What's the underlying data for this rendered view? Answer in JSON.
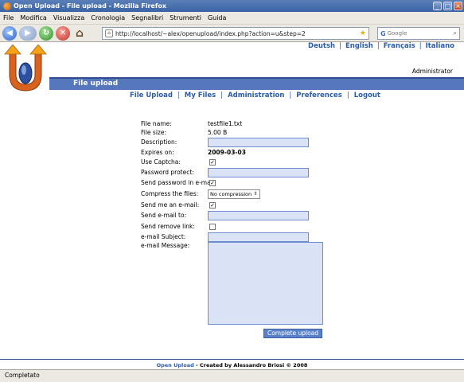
{
  "window": {
    "title": "Open Upload - File upload - Mozilla Firefox",
    "controls": [
      "_",
      "□",
      "×"
    ]
  },
  "menu": [
    "File",
    "Modifica",
    "Visualizza",
    "Cronologia",
    "Segnalibri",
    "Strumenti",
    "Guida"
  ],
  "nav": {
    "url": "http://localhost/~alex/openupload/index.php?action=u&step=2",
    "search_placeholder": "Google"
  },
  "page": {
    "languages": [
      "Deutsh",
      "English",
      "Français",
      "Italiano"
    ],
    "user": "Administrator",
    "section_title": "File upload",
    "tabs": [
      "File Upload",
      "My Files",
      "Administration",
      "Preferences",
      "Logout"
    ],
    "form": {
      "file_name_label": "File name:",
      "file_name_value": "testfile1.txt",
      "file_size_label": "File size:",
      "file_size_value": "5.00 B",
      "description_label": "Description:",
      "expires_label": "Expires on:",
      "expires_value": "2009-03-03",
      "captcha_label": "Use Captcha:",
      "captcha_checked": true,
      "password_label": "Password protect:",
      "send_password_label": "Send password in e-mail:",
      "send_password_checked": true,
      "compress_label": "Compress the files:",
      "compress_value": "No compression",
      "send_me_label": "Send me an e-mail:",
      "send_me_checked": true,
      "send_to_label": "Send e-mail to:",
      "remove_link_label": "Send remove link:",
      "remove_link_checked": false,
      "subject_label": "e-mail Subject:",
      "message_label": "e-mail Message:",
      "submit_label": "Complete upload"
    },
    "footer_link": "Open Upload",
    "footer_text": " - Created by Alessandro Briosi © 2008"
  },
  "status": "Completato"
}
